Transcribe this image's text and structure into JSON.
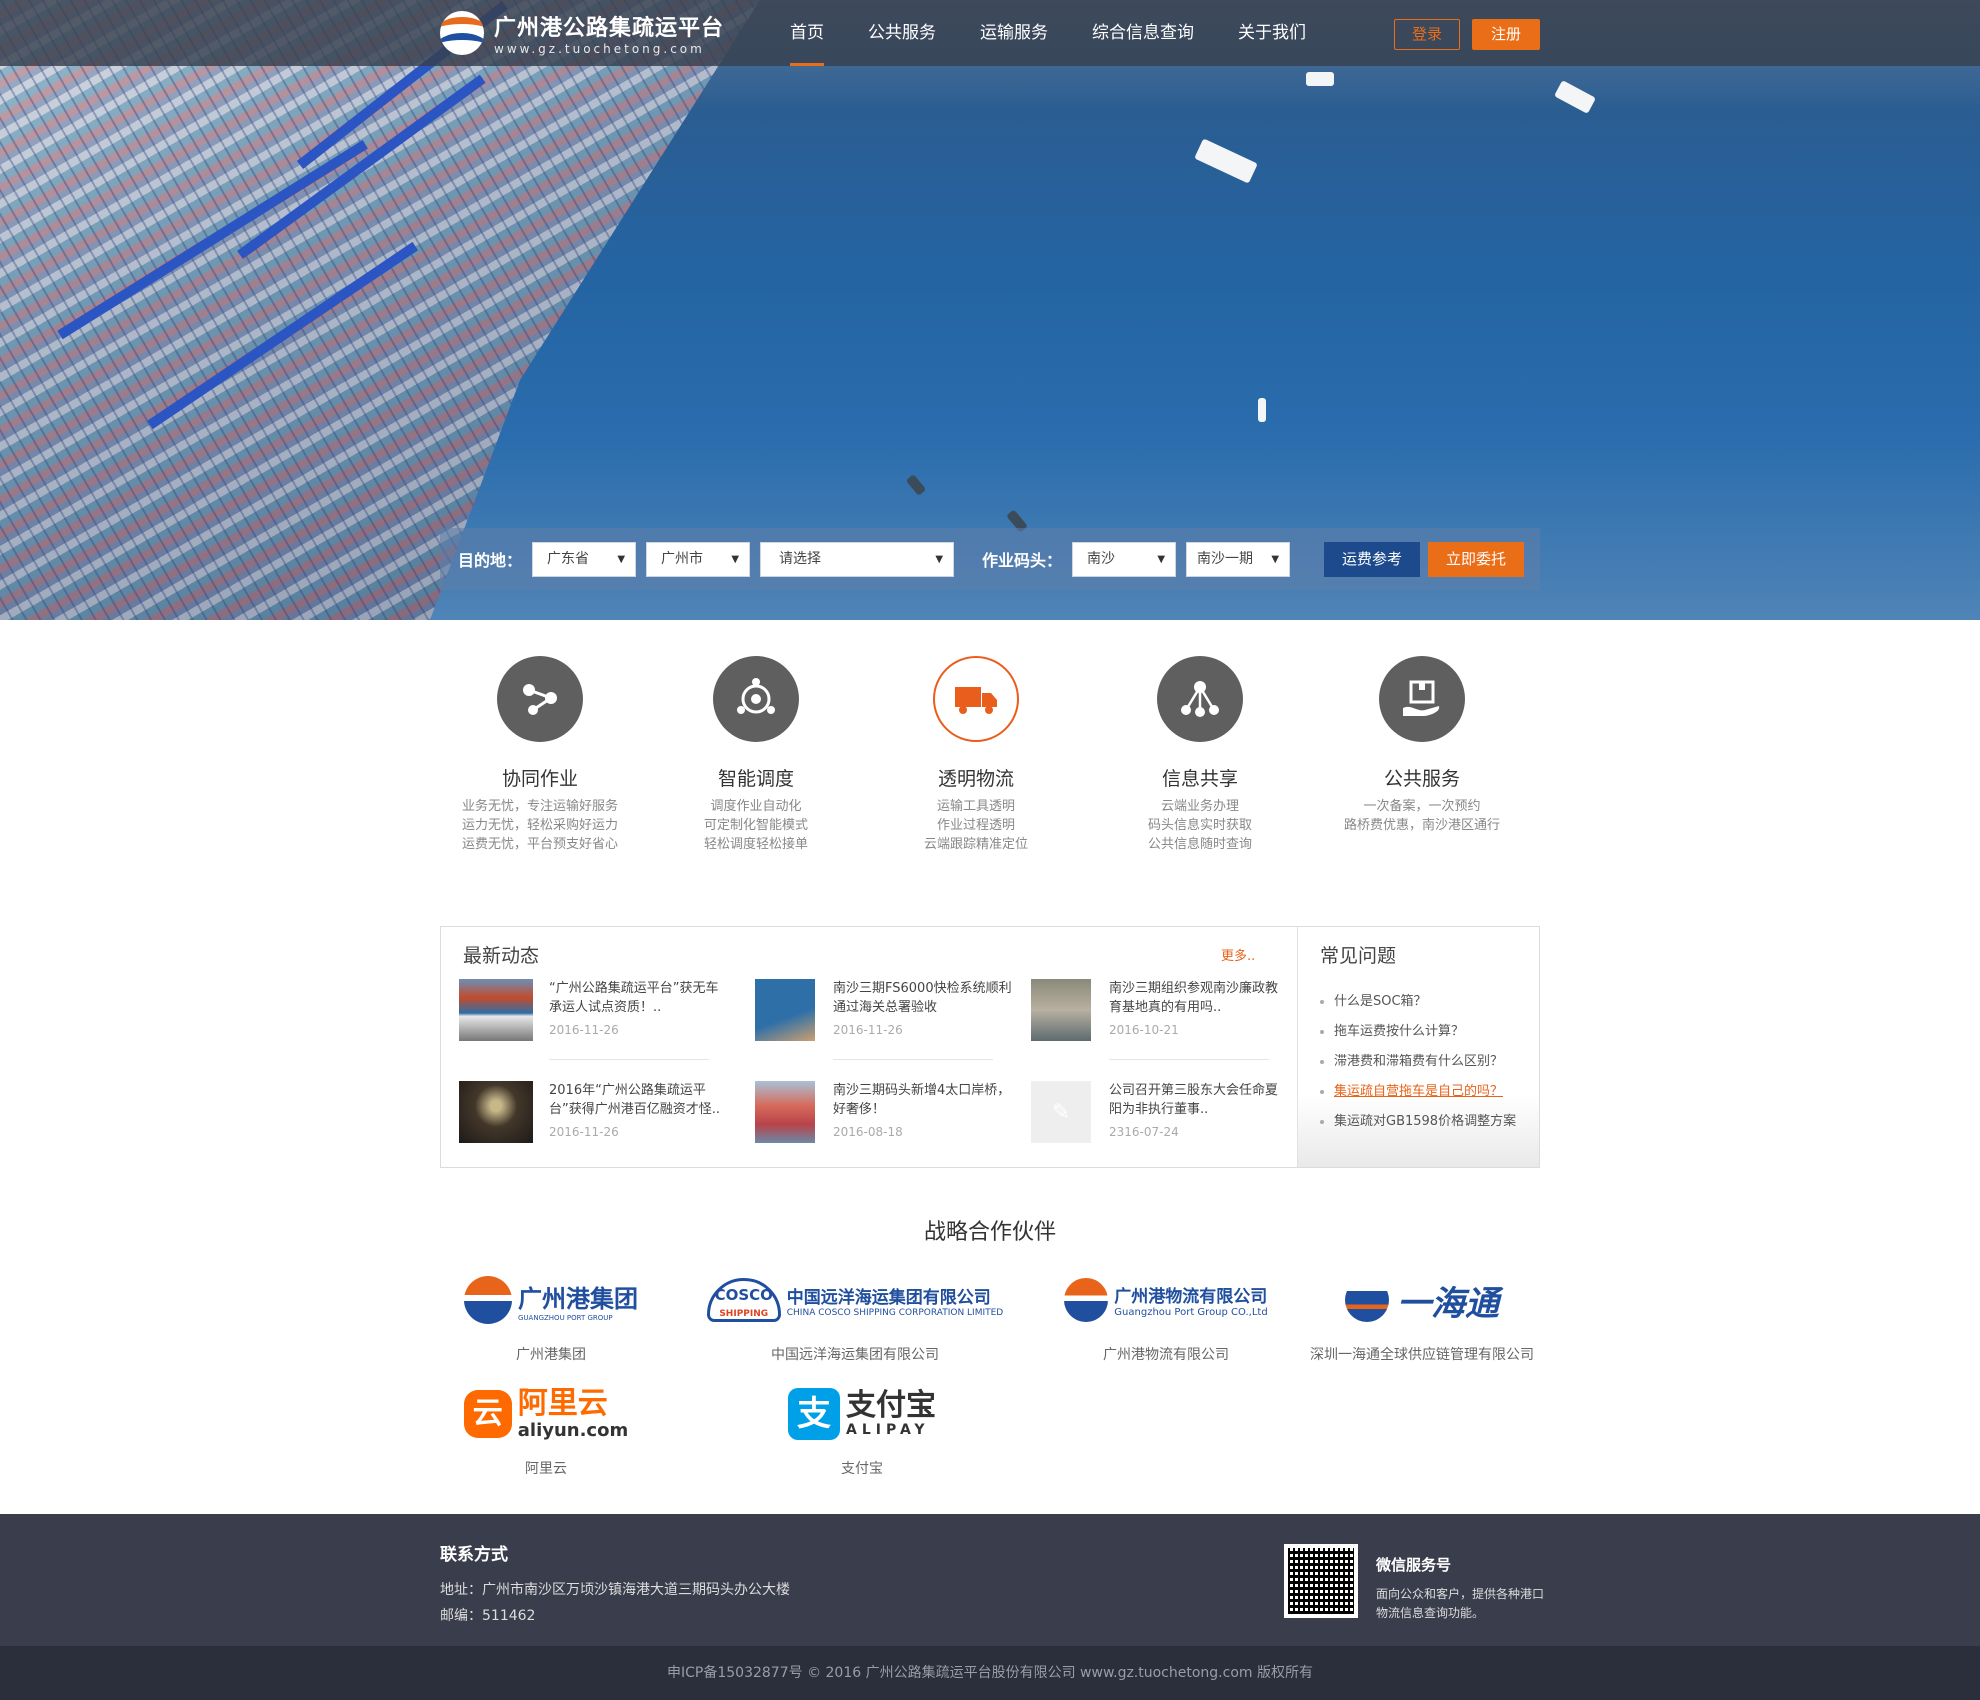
{
  "header": {
    "logo_title": "广州港公路集疏运平台",
    "logo_url": "www.gz.tuochetong.com",
    "nav": [
      "首页",
      "公共服务",
      "运输服务",
      "综合信息查询",
      "关于我们"
    ],
    "login": "登录",
    "register": "注册"
  },
  "search": {
    "dest_label": "目的地：",
    "province": "广东省",
    "city": "广州市",
    "district": "请选择",
    "terminal_label": "作业码头：",
    "terminal": "南沙",
    "terminal_phase": "南沙一期",
    "fee_button": "运费参考",
    "order_button": "立即委托"
  },
  "features": [
    {
      "title": "协同作业",
      "lines": [
        "业务无忧，专注运输好服务",
        "运力无忧，轻松采购好运力",
        "运费无忧，平台预支好省心"
      ]
    },
    {
      "title": "智能调度",
      "lines": [
        "调度作业自动化",
        "可定制化智能模式",
        "轻松调度轻松接单"
      ]
    },
    {
      "title": "透明物流",
      "lines": [
        "运输工具透明",
        "作业过程透明",
        "云端跟踪精准定位"
      ]
    },
    {
      "title": "信息共享",
      "lines": [
        "云端业务办理",
        "码头信息实时获取",
        "公共信息随时查询"
      ]
    },
    {
      "title": "公共服务",
      "lines": [
        "一次备案，一次预约",
        "路桥费优惠，南沙港区通行"
      ]
    }
  ],
  "news": {
    "title": "最新动态",
    "more": "更多..",
    "items": [
      {
        "title": "“广州公路集疏运平台”获无车承运人试点资质！..",
        "date": "2016-11-26"
      },
      {
        "title": "南沙三期FS6000快检系统顺利通过海关总署验收",
        "date": "2016-11-26"
      },
      {
        "title": "南沙三期组织参观南沙廉政教育基地真的有用吗..",
        "date": "2016-10-21"
      },
      {
        "title": "2016年“广州公路集疏运平台”获得广州港百亿融资才怪..",
        "date": "2016-11-26"
      },
      {
        "title": "南沙三期码头新增4太口岸桥，好奢侈！",
        "date": "2016-08-18"
      },
      {
        "title": "公司召开第三股东大会任命夏阳为非执行董事..",
        "date": "2316-07-24"
      }
    ]
  },
  "faq": {
    "title": "常见问题",
    "items": [
      "什么是SOC箱？",
      "拖车运费按什么计算？",
      "滞港费和滞箱费有什么区别？",
      "集运疏自营拖车是自己的吗？",
      "集运疏对GB1598价格调整方案"
    ]
  },
  "partners": {
    "title": "战略合作伙伴",
    "items": [
      {
        "logo": "广州港集团",
        "logo_sub": "GUANGZHOU PORT GROUP",
        "caption": "广州港集团"
      },
      {
        "logo": "中国远洋海运集团有限公司",
        "logo_sub": "CHINA COSCO SHIPPING CORPORATION LIMITED",
        "logo_mark": "COSCO",
        "logo_mark_sub": "SHIPPING",
        "caption": "中国远洋海运集团有限公司"
      },
      {
        "logo": "广州港物流有限公司",
        "logo_sub": "Guangzhou Port Group CO.,Ltd",
        "caption": "广州港物流有限公司"
      },
      {
        "logo": "一海通",
        "caption": "深圳一海通全球供应链管理有限公司"
      },
      {
        "logo": "阿里云",
        "logo_sub": "aliyun.com",
        "caption": "阿里云"
      },
      {
        "logo": "支付宝",
        "logo_sub": "ALIPAY",
        "logo_mark": "支",
        "caption": "支付宝"
      }
    ]
  },
  "footer": {
    "contact_title": "联系方式",
    "address": "地址：广州市南沙区万顷沙镇海港大道三期码头办公大楼",
    "postcode": "邮编：511462",
    "wechat_title": "微信服务号",
    "wechat_desc": "面向公众和客户，提供各种港口物流信息查询功能。",
    "copyright": "申ICP备15032877号 © 2016 广州公路集疏运平台股份有限公司   www.gz.tuochetong.com 版权所有"
  },
  "colors": {
    "accent": "#ea6d17",
    "navy": "#1d4a8c",
    "footer": "#3a3d4c"
  }
}
